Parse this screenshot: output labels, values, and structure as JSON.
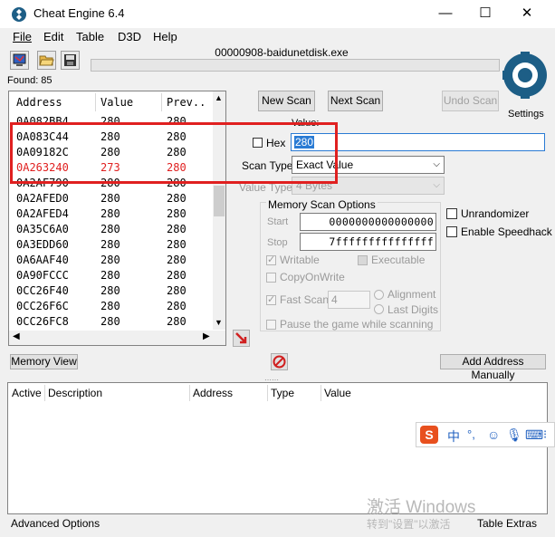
{
  "window": {
    "title": "Cheat Engine 6.4",
    "min_glyph": "—",
    "max_glyph": "☐",
    "close_glyph": "✕"
  },
  "menu": [
    {
      "label": "File",
      "key": "F"
    },
    {
      "label": "Edit",
      "key": "E"
    },
    {
      "label": "Table",
      "key": ""
    },
    {
      "label": "D3D",
      "key": ""
    },
    {
      "label": "Help",
      "key": "H"
    }
  ],
  "process_title": "00000908-baidunetdisk.exe",
  "found": "Found: 85",
  "results": {
    "columns": [
      "Address",
      "Value",
      "Prev.."
    ],
    "rows": [
      {
        "address": "0A082BB4",
        "value": "280",
        "prev": "280",
        "highlight": false
      },
      {
        "address": "0A083C44",
        "value": "280",
        "prev": "280",
        "highlight": false
      },
      {
        "address": "0A09182C",
        "value": "280",
        "prev": "280",
        "highlight": false
      },
      {
        "address": "0A263240",
        "value": "273",
        "prev": "280",
        "highlight": true
      },
      {
        "address": "0A2AF790",
        "value": "280",
        "prev": "280",
        "highlight": false
      },
      {
        "address": "0A2AFED0",
        "value": "280",
        "prev": "280",
        "highlight": false
      },
      {
        "address": "0A2AFED4",
        "value": "280",
        "prev": "280",
        "highlight": false
      },
      {
        "address": "0A35C6A0",
        "value": "280",
        "prev": "280",
        "highlight": false
      },
      {
        "address": "0A3EDD60",
        "value": "280",
        "prev": "280",
        "highlight": false
      },
      {
        "address": "0A6AAF40",
        "value": "280",
        "prev": "280",
        "highlight": false
      },
      {
        "address": "0A90FCCC",
        "value": "280",
        "prev": "280",
        "highlight": false
      },
      {
        "address": "0CC26F40",
        "value": "280",
        "prev": "280",
        "highlight": false
      },
      {
        "address": "0CC26F6C",
        "value": "280",
        "prev": "280",
        "highlight": false
      },
      {
        "address": "0CC26FC8",
        "value": "280",
        "prev": "280",
        "highlight": false
      }
    ]
  },
  "scan": {
    "new_scan": "New Scan",
    "next_scan": "Next Scan",
    "undo_scan": "Undo Scan",
    "settings": "Settings",
    "value_label": "Value:",
    "hex_label": "Hex",
    "value": "280",
    "scan_type_label": "Scan Type",
    "scan_type": "Exact Value",
    "value_type_label": "Value Type",
    "value_type": "4 Bytes"
  },
  "memory_options": {
    "title": "Memory Scan Options",
    "start_label": "Start",
    "start": "0000000000000000",
    "stop_label": "Stop",
    "stop": "7fffffffffffffff",
    "writable": "Writable",
    "executable": "Executable",
    "copy_on_write": "CopyOnWrite",
    "fast_scan": "Fast Scan",
    "fast_scan_value": "4",
    "alignment": "Alignment",
    "last_digits": "Last Digits",
    "pause": "Pause the game while scanning"
  },
  "unrandomizer": "Unrandomizer",
  "speedhack": "Enable Speedhack",
  "memory_view": "Memory View",
  "add_address": "Add Address Manually",
  "address_list": {
    "columns": [
      "Active",
      "Description",
      "Address",
      "Type",
      "Value"
    ]
  },
  "status": {
    "advanced": "Advanced Options",
    "table_extras": "Table Extras"
  },
  "ime": {
    "logo": "S",
    "lang": "中",
    "punct": "°,"
  },
  "watermark": {
    "line1": "激活 Windows",
    "line2": "转到\"设置\"以激活"
  },
  "colors": {
    "highlight_red": "#e02020",
    "value_box_border": "#2a7bd4"
  }
}
